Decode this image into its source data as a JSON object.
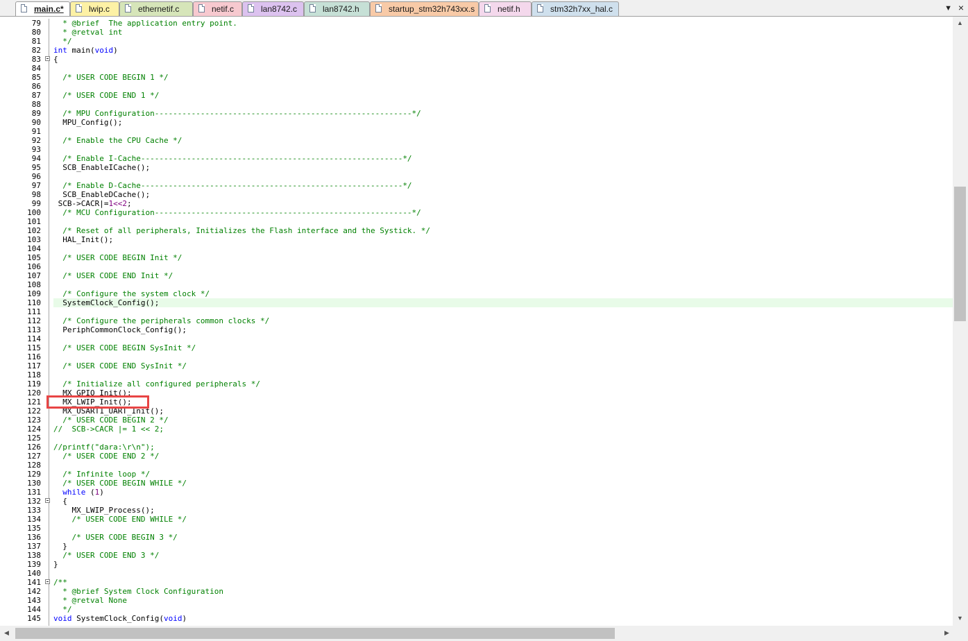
{
  "tabs": [
    {
      "label": "main.c*",
      "active": true,
      "color": "#ffffff"
    },
    {
      "label": "lwip.c",
      "active": false,
      "color": "#fdf1a5"
    },
    {
      "label": "ethernetif.c",
      "active": false,
      "color": "#d6e5b9"
    },
    {
      "label": "netif.c",
      "active": false,
      "color": "#f7c9cf"
    },
    {
      "label": "lan8742.c",
      "active": false,
      "color": "#dcc2ef"
    },
    {
      "label": "lan8742.h",
      "active": false,
      "color": "#c6e0d6"
    },
    {
      "label": "startup_stm32h743xx.s",
      "active": false,
      "color": "#f8caa7"
    },
    {
      "label": "netif.h",
      "active": false,
      "color": "#f4d8ec"
    },
    {
      "label": "stm32h7xx_hal.c",
      "active": false,
      "color": "#cfe0ed"
    }
  ],
  "tab_menu_icon": "chevron-down-icon",
  "tab_close_icon": "close-icon",
  "highlight_color": "#e8fbe8",
  "annotation_color": "#e84545",
  "lines": [
    {
      "n": "79",
      "fold": false,
      "hl": false,
      "segs": [
        {
          "t": "c",
          "s": "  * @brief  The application entry point."
        }
      ]
    },
    {
      "n": "80",
      "fold": false,
      "hl": false,
      "segs": [
        {
          "t": "c",
          "s": "  * @retval int"
        }
      ]
    },
    {
      "n": "81",
      "fold": false,
      "hl": false,
      "segs": [
        {
          "t": "c",
          "s": "  */"
        }
      ]
    },
    {
      "n": "82",
      "fold": false,
      "hl": false,
      "segs": [
        {
          "t": "k",
          "s": "int"
        },
        {
          "t": "d",
          "s": " main("
        },
        {
          "t": "k",
          "s": "void"
        },
        {
          "t": "d",
          "s": ")"
        }
      ]
    },
    {
      "n": "83",
      "fold": true,
      "hl": false,
      "segs": [
        {
          "t": "d",
          "s": "{"
        }
      ]
    },
    {
      "n": "84",
      "fold": false,
      "hl": false,
      "segs": []
    },
    {
      "n": "85",
      "fold": false,
      "hl": false,
      "segs": [
        {
          "t": "c",
          "s": "  /* USER CODE BEGIN 1 */"
        }
      ]
    },
    {
      "n": "86",
      "fold": false,
      "hl": false,
      "segs": []
    },
    {
      "n": "87",
      "fold": false,
      "hl": false,
      "segs": [
        {
          "t": "c",
          "s": "  /* USER CODE END 1 */"
        }
      ]
    },
    {
      "n": "88",
      "fold": false,
      "hl": false,
      "segs": []
    },
    {
      "n": "89",
      "fold": false,
      "hl": false,
      "segs": [
        {
          "t": "c",
          "s": "  /* MPU Configuration--------------------------------------------------------*/"
        }
      ]
    },
    {
      "n": "90",
      "fold": false,
      "hl": false,
      "segs": [
        {
          "t": "d",
          "s": "  MPU_Config();"
        }
      ]
    },
    {
      "n": "91",
      "fold": false,
      "hl": false,
      "segs": []
    },
    {
      "n": "92",
      "fold": false,
      "hl": false,
      "segs": [
        {
          "t": "c",
          "s": "  /* Enable the CPU Cache */"
        }
      ]
    },
    {
      "n": "93",
      "fold": false,
      "hl": false,
      "segs": []
    },
    {
      "n": "94",
      "fold": false,
      "hl": false,
      "segs": [
        {
          "t": "c",
          "s": "  /* Enable I-Cache---------------------------------------------------------*/"
        }
      ]
    },
    {
      "n": "95",
      "fold": false,
      "hl": false,
      "segs": [
        {
          "t": "d",
          "s": "  SCB_EnableICache();"
        }
      ]
    },
    {
      "n": "96",
      "fold": false,
      "hl": false,
      "segs": []
    },
    {
      "n": "97",
      "fold": false,
      "hl": false,
      "segs": [
        {
          "t": "c",
          "s": "  /* Enable D-Cache---------------------------------------------------------*/"
        }
      ]
    },
    {
      "n": "98",
      "fold": false,
      "hl": false,
      "segs": [
        {
          "t": "d",
          "s": "  SCB_EnableDCache();"
        }
      ]
    },
    {
      "n": "99",
      "fold": false,
      "hl": false,
      "segs": [
        {
          "t": "d",
          "s": " SCB->CACR|="
        },
        {
          "t": "n",
          "s": "1<<2"
        },
        {
          "t": "d",
          "s": ";"
        }
      ]
    },
    {
      "n": "100",
      "fold": false,
      "hl": false,
      "segs": [
        {
          "t": "c",
          "s": "  /* MCU Configuration--------------------------------------------------------*/"
        }
      ]
    },
    {
      "n": "101",
      "fold": false,
      "hl": false,
      "segs": []
    },
    {
      "n": "102",
      "fold": false,
      "hl": false,
      "segs": [
        {
          "t": "c",
          "s": "  /* Reset of all peripherals, Initializes the Flash interface and the Systick. */"
        }
      ]
    },
    {
      "n": "103",
      "fold": false,
      "hl": false,
      "segs": [
        {
          "t": "d",
          "s": "  HAL_Init();"
        }
      ]
    },
    {
      "n": "104",
      "fold": false,
      "hl": false,
      "segs": []
    },
    {
      "n": "105",
      "fold": false,
      "hl": false,
      "segs": [
        {
          "t": "c",
          "s": "  /* USER CODE BEGIN Init */"
        }
      ]
    },
    {
      "n": "106",
      "fold": false,
      "hl": false,
      "segs": []
    },
    {
      "n": "107",
      "fold": false,
      "hl": false,
      "segs": [
        {
          "t": "c",
          "s": "  /* USER CODE END Init */"
        }
      ]
    },
    {
      "n": "108",
      "fold": false,
      "hl": false,
      "segs": []
    },
    {
      "n": "109",
      "fold": false,
      "hl": false,
      "segs": [
        {
          "t": "c",
          "s": "  /* Configure the system clock */"
        }
      ]
    },
    {
      "n": "110",
      "fold": false,
      "hl": true,
      "segs": [
        {
          "t": "d",
          "s": "  SystemClock_Config();"
        }
      ]
    },
    {
      "n": "111",
      "fold": false,
      "hl": false,
      "segs": []
    },
    {
      "n": "112",
      "fold": false,
      "hl": false,
      "segs": [
        {
          "t": "c",
          "s": "  /* Configure the peripherals common clocks */"
        }
      ]
    },
    {
      "n": "113",
      "fold": false,
      "hl": false,
      "segs": [
        {
          "t": "d",
          "s": "  PeriphCommonClock_Config();"
        }
      ]
    },
    {
      "n": "114",
      "fold": false,
      "hl": false,
      "segs": []
    },
    {
      "n": "115",
      "fold": false,
      "hl": false,
      "segs": [
        {
          "t": "c",
          "s": "  /* USER CODE BEGIN SysInit */"
        }
      ]
    },
    {
      "n": "116",
      "fold": false,
      "hl": false,
      "segs": []
    },
    {
      "n": "117",
      "fold": false,
      "hl": false,
      "segs": [
        {
          "t": "c",
          "s": "  /* USER CODE END SysInit */"
        }
      ]
    },
    {
      "n": "118",
      "fold": false,
      "hl": false,
      "segs": []
    },
    {
      "n": "119",
      "fold": false,
      "hl": false,
      "segs": [
        {
          "t": "c",
          "s": "  /* Initialize all configured peripherals */"
        }
      ]
    },
    {
      "n": "120",
      "fold": false,
      "hl": false,
      "segs": [
        {
          "t": "d",
          "s": "  MX_GPIO_Init();"
        }
      ]
    },
    {
      "n": "121",
      "fold": false,
      "hl": false,
      "segs": [
        {
          "t": "d",
          "s": "  MX_LWIP_Init();"
        }
      ]
    },
    {
      "n": "122",
      "fold": false,
      "hl": false,
      "segs": [
        {
          "t": "d",
          "s": "  MX_USART1_UART_Init();"
        }
      ]
    },
    {
      "n": "123",
      "fold": false,
      "hl": false,
      "segs": [
        {
          "t": "c",
          "s": "  /* USER CODE BEGIN 2 */"
        }
      ]
    },
    {
      "n": "124",
      "fold": false,
      "hl": false,
      "segs": [
        {
          "t": "c",
          "s": "//  SCB->CACR |= 1 << 2;"
        }
      ]
    },
    {
      "n": "125",
      "fold": false,
      "hl": false,
      "segs": []
    },
    {
      "n": "126",
      "fold": false,
      "hl": false,
      "segs": [
        {
          "t": "c",
          "s": "//printf(\"dara:\\r\\n\");"
        }
      ]
    },
    {
      "n": "127",
      "fold": false,
      "hl": false,
      "segs": [
        {
          "t": "c",
          "s": "  /* USER CODE END 2 */"
        }
      ]
    },
    {
      "n": "128",
      "fold": false,
      "hl": false,
      "segs": []
    },
    {
      "n": "129",
      "fold": false,
      "hl": false,
      "segs": [
        {
          "t": "c",
          "s": "  /* Infinite loop */"
        }
      ]
    },
    {
      "n": "130",
      "fold": false,
      "hl": false,
      "segs": [
        {
          "t": "c",
          "s": "  /* USER CODE BEGIN WHILE */"
        }
      ]
    },
    {
      "n": "131",
      "fold": false,
      "hl": false,
      "segs": [
        {
          "t": "k",
          "s": "  while"
        },
        {
          "t": "d",
          "s": " ("
        },
        {
          "t": "n",
          "s": "1"
        },
        {
          "t": "d",
          "s": ")"
        }
      ]
    },
    {
      "n": "132",
      "fold": true,
      "hl": false,
      "segs": [
        {
          "t": "d",
          "s": "  {"
        }
      ]
    },
    {
      "n": "133",
      "fold": false,
      "hl": false,
      "segs": [
        {
          "t": "d",
          "s": "    MX_LWIP_Process();"
        }
      ]
    },
    {
      "n": "134",
      "fold": false,
      "hl": false,
      "segs": [
        {
          "t": "c",
          "s": "    /* USER CODE END WHILE */"
        }
      ]
    },
    {
      "n": "135",
      "fold": false,
      "hl": false,
      "segs": []
    },
    {
      "n": "136",
      "fold": false,
      "hl": false,
      "segs": [
        {
          "t": "c",
          "s": "    /* USER CODE BEGIN 3 */"
        }
      ]
    },
    {
      "n": "137",
      "fold": false,
      "hl": false,
      "segs": [
        {
          "t": "d",
          "s": "  }"
        }
      ]
    },
    {
      "n": "138",
      "fold": false,
      "hl": false,
      "segs": [
        {
          "t": "c",
          "s": "  /* USER CODE END 3 */"
        }
      ]
    },
    {
      "n": "139",
      "fold": false,
      "hl": false,
      "segs": [
        {
          "t": "d",
          "s": "}"
        }
      ]
    },
    {
      "n": "140",
      "fold": false,
      "hl": false,
      "segs": []
    },
    {
      "n": "141",
      "fold": true,
      "hl": false,
      "segs": [
        {
          "t": "c",
          "s": "/**"
        }
      ]
    },
    {
      "n": "142",
      "fold": false,
      "hl": false,
      "segs": [
        {
          "t": "c",
          "s": "  * @brief System Clock Configuration"
        }
      ]
    },
    {
      "n": "143",
      "fold": false,
      "hl": false,
      "segs": [
        {
          "t": "c",
          "s": "  * @retval None"
        }
      ]
    },
    {
      "n": "144",
      "fold": false,
      "hl": false,
      "segs": [
        {
          "t": "c",
          "s": "  */"
        }
      ]
    },
    {
      "n": "145",
      "fold": false,
      "hl": false,
      "segs": [
        {
          "t": "k",
          "s": "void"
        },
        {
          "t": "d",
          "s": " SystemClock_Config("
        },
        {
          "t": "k",
          "s": "void"
        },
        {
          "t": "d",
          "s": ")"
        }
      ]
    }
  ]
}
